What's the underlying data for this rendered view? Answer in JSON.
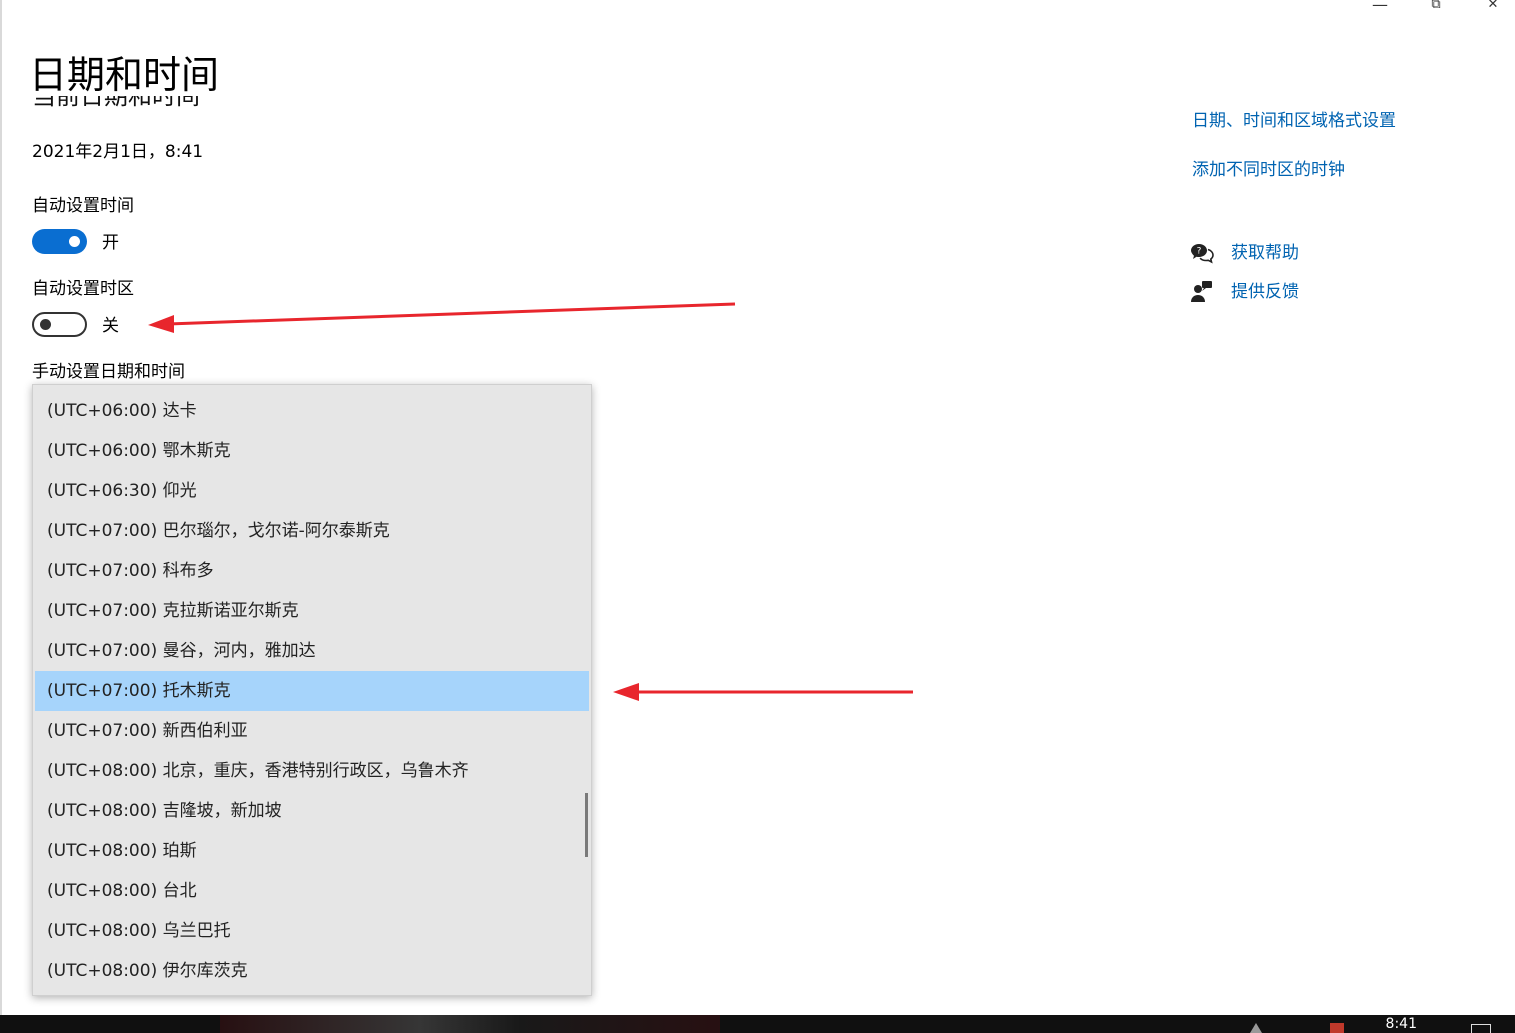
{
  "window": {
    "minimize_glyph": "—",
    "maximize_glyph": "⧉",
    "close_glyph": "✕"
  },
  "page": {
    "title": "日期和时间",
    "clipped_heading": "当前日期和时间",
    "current_datetime": "2021年2月1日，8:41"
  },
  "settings": {
    "auto_time_label": "自动设置时间",
    "auto_time_state": "开",
    "auto_timezone_label": "自动设置时区",
    "auto_timezone_state": "关",
    "manual_label": "手动设置日期和时间"
  },
  "timezone_dropdown": {
    "selected_index": 7,
    "options": [
      "(UTC+06:00) 达卡",
      "(UTC+06:00) 鄂木斯克",
      "(UTC+06:30) 仰光",
      "(UTC+07:00) 巴尔瑙尔，戈尔诺-阿尔泰斯克",
      "(UTC+07:00) 科布多",
      "(UTC+07:00) 克拉斯诺亚尔斯克",
      "(UTC+07:00) 曼谷，河内，雅加达",
      "(UTC+07:00) 托木斯克",
      "(UTC+07:00) 新西伯利亚",
      "(UTC+08:00) 北京，重庆，香港特别行政区，乌鲁木齐",
      "(UTC+08:00) 吉隆坡，新加坡",
      "(UTC+08:00) 珀斯",
      "(UTC+08:00) 台北",
      "(UTC+08:00) 乌兰巴托",
      "(UTC+08:00) 伊尔库茨克"
    ]
  },
  "related": {
    "link_region_format": "日期、时间和区域格式设置",
    "link_add_clocks": "添加不同时区的时钟",
    "get_help": "获取帮助",
    "feedback": "提供反馈"
  },
  "taskbar": {
    "clock": "8:41"
  },
  "colors": {
    "accent": "#0a6ed1",
    "link": "#0063b1",
    "selected_row": "#a6d4fb",
    "dropdown_bg": "#e6e6e6",
    "annotation_arrow": "#e8262d"
  },
  "icons": {
    "help": "chat-help-icon",
    "feedback": "person-feedback-icon"
  }
}
